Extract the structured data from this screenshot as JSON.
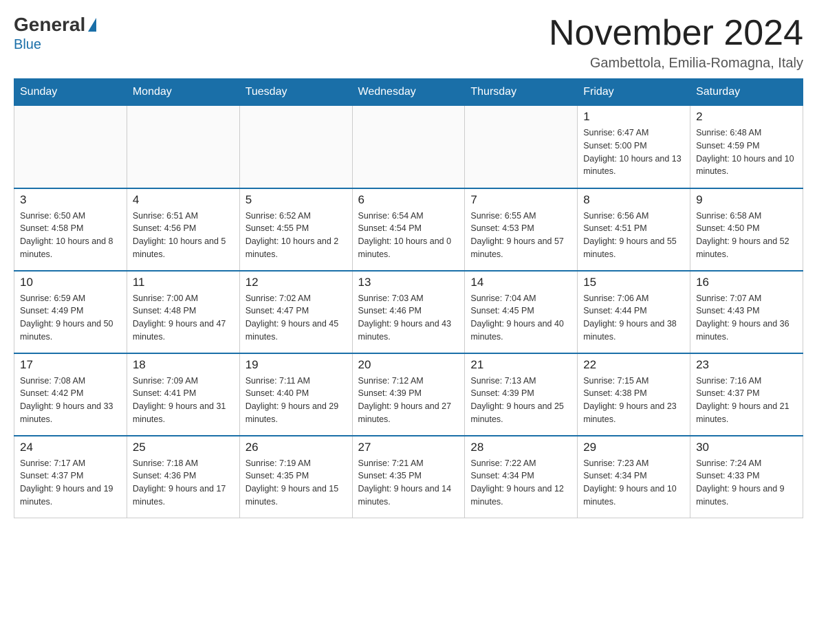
{
  "header": {
    "logo_general": "General",
    "logo_blue": "Blue",
    "month_title": "November 2024",
    "location": "Gambettola, Emilia-Romagna, Italy"
  },
  "weekdays": [
    "Sunday",
    "Monday",
    "Tuesday",
    "Wednesday",
    "Thursday",
    "Friday",
    "Saturday"
  ],
  "weeks": [
    [
      {
        "day": "",
        "info": ""
      },
      {
        "day": "",
        "info": ""
      },
      {
        "day": "",
        "info": ""
      },
      {
        "day": "",
        "info": ""
      },
      {
        "day": "",
        "info": ""
      },
      {
        "day": "1",
        "info": "Sunrise: 6:47 AM\nSunset: 5:00 PM\nDaylight: 10 hours and 13 minutes."
      },
      {
        "day": "2",
        "info": "Sunrise: 6:48 AM\nSunset: 4:59 PM\nDaylight: 10 hours and 10 minutes."
      }
    ],
    [
      {
        "day": "3",
        "info": "Sunrise: 6:50 AM\nSunset: 4:58 PM\nDaylight: 10 hours and 8 minutes."
      },
      {
        "day": "4",
        "info": "Sunrise: 6:51 AM\nSunset: 4:56 PM\nDaylight: 10 hours and 5 minutes."
      },
      {
        "day": "5",
        "info": "Sunrise: 6:52 AM\nSunset: 4:55 PM\nDaylight: 10 hours and 2 minutes."
      },
      {
        "day": "6",
        "info": "Sunrise: 6:54 AM\nSunset: 4:54 PM\nDaylight: 10 hours and 0 minutes."
      },
      {
        "day": "7",
        "info": "Sunrise: 6:55 AM\nSunset: 4:53 PM\nDaylight: 9 hours and 57 minutes."
      },
      {
        "day": "8",
        "info": "Sunrise: 6:56 AM\nSunset: 4:51 PM\nDaylight: 9 hours and 55 minutes."
      },
      {
        "day": "9",
        "info": "Sunrise: 6:58 AM\nSunset: 4:50 PM\nDaylight: 9 hours and 52 minutes."
      }
    ],
    [
      {
        "day": "10",
        "info": "Sunrise: 6:59 AM\nSunset: 4:49 PM\nDaylight: 9 hours and 50 minutes."
      },
      {
        "day": "11",
        "info": "Sunrise: 7:00 AM\nSunset: 4:48 PM\nDaylight: 9 hours and 47 minutes."
      },
      {
        "day": "12",
        "info": "Sunrise: 7:02 AM\nSunset: 4:47 PM\nDaylight: 9 hours and 45 minutes."
      },
      {
        "day": "13",
        "info": "Sunrise: 7:03 AM\nSunset: 4:46 PM\nDaylight: 9 hours and 43 minutes."
      },
      {
        "day": "14",
        "info": "Sunrise: 7:04 AM\nSunset: 4:45 PM\nDaylight: 9 hours and 40 minutes."
      },
      {
        "day": "15",
        "info": "Sunrise: 7:06 AM\nSunset: 4:44 PM\nDaylight: 9 hours and 38 minutes."
      },
      {
        "day": "16",
        "info": "Sunrise: 7:07 AM\nSunset: 4:43 PM\nDaylight: 9 hours and 36 minutes."
      }
    ],
    [
      {
        "day": "17",
        "info": "Sunrise: 7:08 AM\nSunset: 4:42 PM\nDaylight: 9 hours and 33 minutes."
      },
      {
        "day": "18",
        "info": "Sunrise: 7:09 AM\nSunset: 4:41 PM\nDaylight: 9 hours and 31 minutes."
      },
      {
        "day": "19",
        "info": "Sunrise: 7:11 AM\nSunset: 4:40 PM\nDaylight: 9 hours and 29 minutes."
      },
      {
        "day": "20",
        "info": "Sunrise: 7:12 AM\nSunset: 4:39 PM\nDaylight: 9 hours and 27 minutes."
      },
      {
        "day": "21",
        "info": "Sunrise: 7:13 AM\nSunset: 4:39 PM\nDaylight: 9 hours and 25 minutes."
      },
      {
        "day": "22",
        "info": "Sunrise: 7:15 AM\nSunset: 4:38 PM\nDaylight: 9 hours and 23 minutes."
      },
      {
        "day": "23",
        "info": "Sunrise: 7:16 AM\nSunset: 4:37 PM\nDaylight: 9 hours and 21 minutes."
      }
    ],
    [
      {
        "day": "24",
        "info": "Sunrise: 7:17 AM\nSunset: 4:37 PM\nDaylight: 9 hours and 19 minutes."
      },
      {
        "day": "25",
        "info": "Sunrise: 7:18 AM\nSunset: 4:36 PM\nDaylight: 9 hours and 17 minutes."
      },
      {
        "day": "26",
        "info": "Sunrise: 7:19 AM\nSunset: 4:35 PM\nDaylight: 9 hours and 15 minutes."
      },
      {
        "day": "27",
        "info": "Sunrise: 7:21 AM\nSunset: 4:35 PM\nDaylight: 9 hours and 14 minutes."
      },
      {
        "day": "28",
        "info": "Sunrise: 7:22 AM\nSunset: 4:34 PM\nDaylight: 9 hours and 12 minutes."
      },
      {
        "day": "29",
        "info": "Sunrise: 7:23 AM\nSunset: 4:34 PM\nDaylight: 9 hours and 10 minutes."
      },
      {
        "day": "30",
        "info": "Sunrise: 7:24 AM\nSunset: 4:33 PM\nDaylight: 9 hours and 9 minutes."
      }
    ]
  ]
}
